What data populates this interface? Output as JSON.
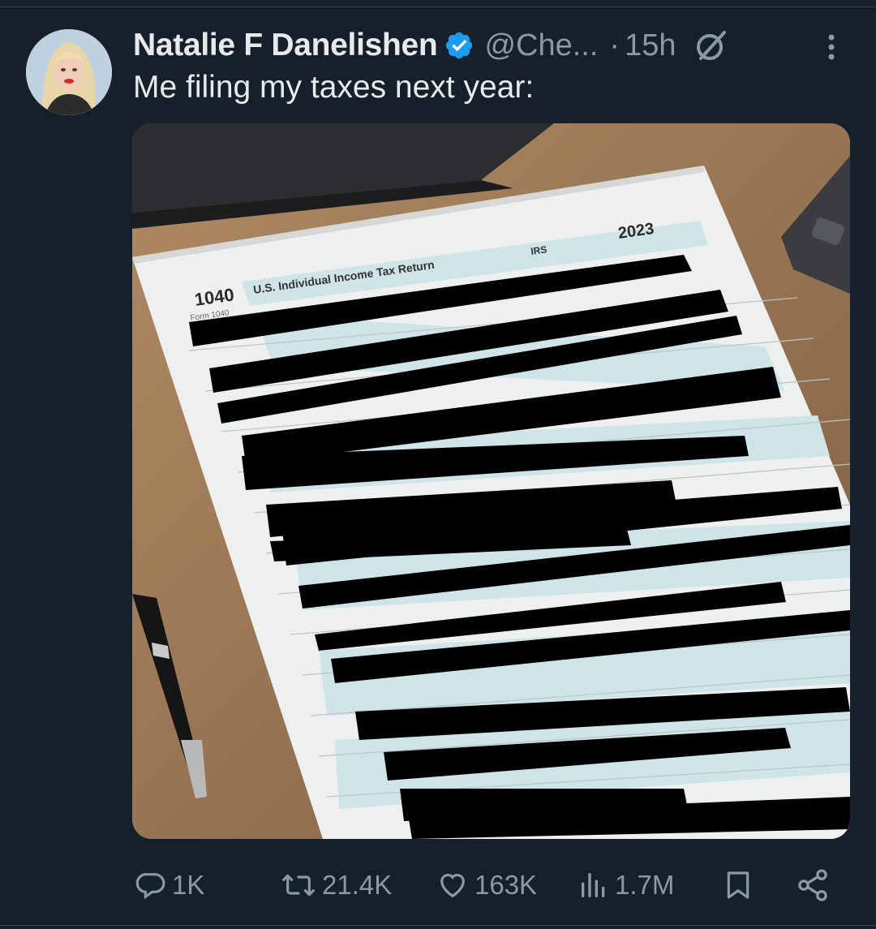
{
  "tweet": {
    "author_name": "Natalie F Danelishen",
    "handle": "@Che...",
    "separator": "·",
    "time": "15h",
    "text": "Me filing my taxes next year:"
  },
  "media": {
    "form_number": "1040",
    "form_subtitle": "Form 1040",
    "form_title": "U.S. Individual Income Tax Return",
    "form_agency": "IRS",
    "form_year": "2023"
  },
  "actions": {
    "replies": "1K",
    "reposts": "21.4K",
    "likes": "163K",
    "views": "1.7M"
  },
  "colors": {
    "background": "#15202b",
    "secondary_text": "#8b98a5",
    "verified_blue": "#1d9bf0",
    "form_teal": "#cfe4e6"
  },
  "icons": [
    "verified-badge-icon",
    "grok-icon",
    "more-icon",
    "reply-icon",
    "repost-icon",
    "like-icon",
    "views-icon",
    "bookmark-icon",
    "share-icon"
  ]
}
